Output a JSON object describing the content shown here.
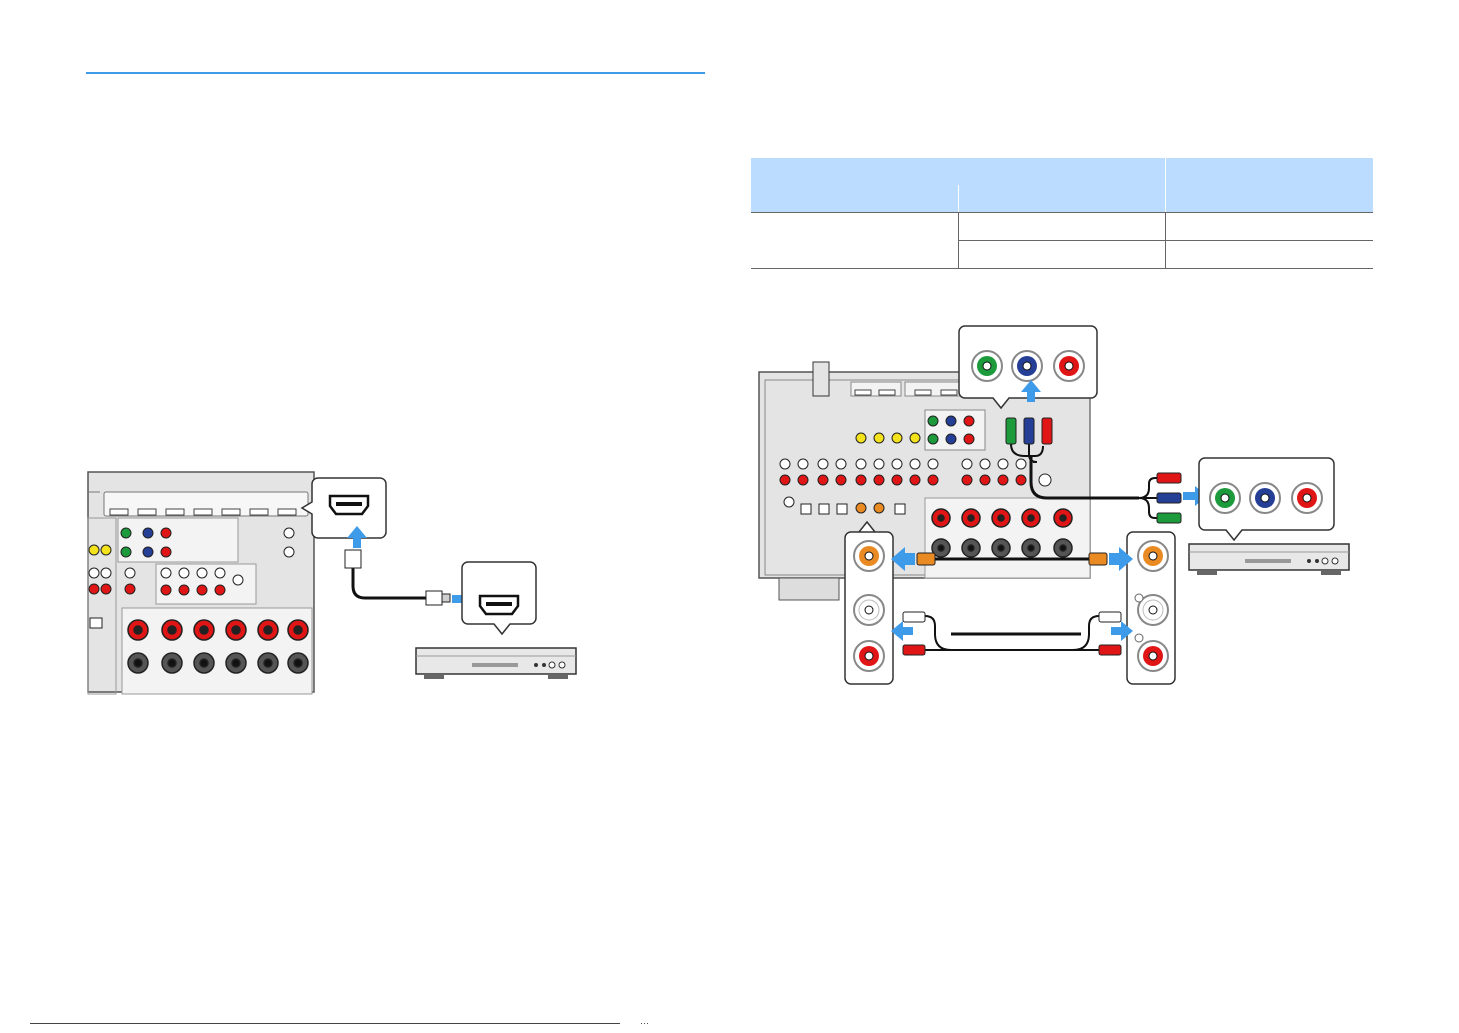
{
  "page": {
    "title_rule_color": "#3d9be9",
    "accent_arrow_color": "#3d9be9",
    "table_header_color": "#bcdcff"
  },
  "table": {
    "header_group": "",
    "header_right": "",
    "sub_header_1": "",
    "sub_header_2": "",
    "rows": [
      {
        "col1": "",
        "col2": "",
        "col3": ""
      },
      {
        "col1": "",
        "col2": "",
        "col3": ""
      }
    ]
  },
  "figure_left": {
    "description_icons": [
      "receiver-rear-panel",
      "hdmi-port-icon",
      "hdmi-cable-icon",
      "player-device-icon",
      "arrow-icon"
    ]
  },
  "figure_right": {
    "description_icons": [
      "receiver-rear-panel",
      "component-jacks-icon",
      "component-cable-icon",
      "coaxial-cable-icon",
      "analog-audio-cable-icon",
      "player-device-icon",
      "arrow-icon"
    ],
    "jack_colors": {
      "green": "#1c9a3c",
      "blue": "#253f97",
      "red": "#e01515",
      "orange": "#ea8a22",
      "white": "#ffffff"
    }
  },
  "footer": {
    "text": "···"
  }
}
